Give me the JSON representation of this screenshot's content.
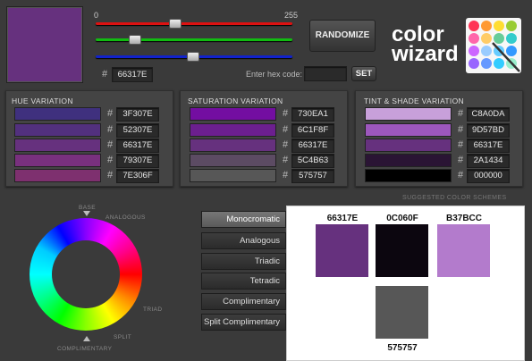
{
  "current": {
    "hex": "66317E",
    "color": "#66317E"
  },
  "sliders": {
    "min_label": "0",
    "max_label": "255",
    "red": 102,
    "green": 49,
    "blue": 126
  },
  "buttons": {
    "randomize": "RANDOMIZE",
    "set": "SET"
  },
  "hex_input": {
    "label": "Enter hex code:",
    "value": ""
  },
  "logo": {
    "line1": "color",
    "line2": "wizard"
  },
  "hue_panel": {
    "title": "HUE VARIATION",
    "items": [
      {
        "hex": "3F307E",
        "color": "#3F307E"
      },
      {
        "hex": "52307E",
        "color": "#52307E"
      },
      {
        "hex": "66317E",
        "color": "#66317E"
      },
      {
        "hex": "79307E",
        "color": "#79307E"
      },
      {
        "hex": "7E306F",
        "color": "#7E306F"
      }
    ]
  },
  "saturation_panel": {
    "title": "SATURATION VARIATION",
    "items": [
      {
        "hex": "730EA1",
        "color": "#730EA1"
      },
      {
        "hex": "6C1F8F",
        "color": "#6C1F8F"
      },
      {
        "hex": "66317E",
        "color": "#66317E"
      },
      {
        "hex": "5C4B63",
        "color": "#5C4B63"
      },
      {
        "hex": "575757",
        "color": "#575757"
      }
    ]
  },
  "tint_panel": {
    "title": "TINT & SHADE VARIATION",
    "items": [
      {
        "hex": "C8A0DA",
        "color": "#C8A0DA"
      },
      {
        "hex": "9D57BD",
        "color": "#9D57BD"
      },
      {
        "hex": "66317E",
        "color": "#66317E"
      },
      {
        "hex": "2A1434",
        "color": "#2A1434"
      },
      {
        "hex": "000000",
        "color": "#000000"
      }
    ]
  },
  "wheel_labels": {
    "base": "BASE",
    "analogous": "ANALOGOUS",
    "triad": "TRIAD",
    "split": "SPLIT",
    "complimentary": "COMPLIMENTARY"
  },
  "schemes": {
    "section_title": "SUGGESTED COLOR SCHEMES",
    "buttons": [
      "Monocromatic",
      "Analogous",
      "Triadic",
      "Tetradic",
      "Complimentary",
      "Split Complimentary"
    ],
    "active": "Monocromatic",
    "swatches": [
      {
        "hex": "66317E",
        "color": "#66317E"
      },
      {
        "hex": "0C060F",
        "color": "#0C060F"
      },
      {
        "hex": "B37BCC",
        "color": "#B37BCC"
      },
      {
        "hex": "575757",
        "color": "#575757"
      }
    ]
  }
}
